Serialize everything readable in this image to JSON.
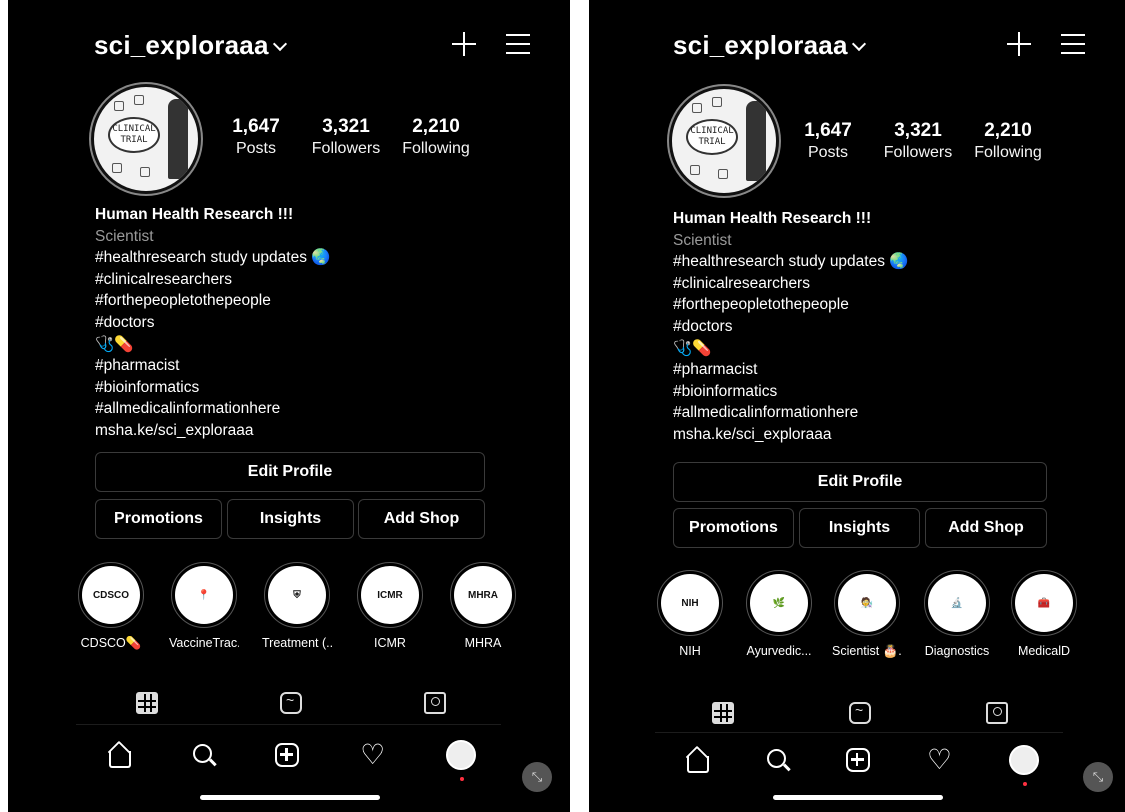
{
  "left": {
    "username": "sci_exploraaa",
    "avatar_text": "CLINICAL TRIAL",
    "stats": [
      {
        "num": "1,647",
        "label": "Posts"
      },
      {
        "num": "3,321",
        "label": "Followers"
      },
      {
        "num": "2,210",
        "label": "Following"
      }
    ],
    "bio": {
      "name": "Human Health Research !!!",
      "category": "Scientist",
      "lines": [
        "#healthresearch study updates 🌏",
        "#clinicalresearchers",
        "#forthepeopletothepeople",
        "#doctors",
        "🩺💊",
        "#pharmacist",
        "#bioinformatics",
        "#allmedicalinformationhere",
        "msha.ke/sci_exploraaa"
      ]
    },
    "buttons": {
      "edit": "Edit Profile",
      "promotions": "Promotions",
      "insights": "Insights",
      "add_shop": "Add Shop"
    },
    "highlights": [
      {
        "label": "CDSCO💊",
        "inner": "CDSCO"
      },
      {
        "label": "VaccineTrac...",
        "inner": "📍"
      },
      {
        "label": "Treatment (...",
        "inner": "⛨"
      },
      {
        "label": "ICMR",
        "inner": "ICMR"
      },
      {
        "label": "MHRA",
        "inner": "MHRA"
      }
    ]
  },
  "right": {
    "username": "sci_exploraaa",
    "avatar_text": "CLINICAL TRIAL",
    "stats": [
      {
        "num": "1,647",
        "label": "Posts"
      },
      {
        "num": "3,321",
        "label": "Followers"
      },
      {
        "num": "2,210",
        "label": "Following"
      }
    ],
    "bio": {
      "name": "Human Health Research !!!",
      "category": "Scientist",
      "lines": [
        "#healthresearch study updates 🌏",
        "#clinicalresearchers",
        "#forthepeopletothepeople",
        "#doctors",
        "🩺💊",
        "#pharmacist",
        "#bioinformatics",
        "#allmedicalinformationhere",
        "msha.ke/sci_exploraaa"
      ]
    },
    "buttons": {
      "edit": "Edit Profile",
      "promotions": "Promotions",
      "insights": "Insights",
      "add_shop": "Add Shop"
    },
    "highlights": [
      {
        "label": "NIH",
        "inner": "NIH"
      },
      {
        "label": "Ayurvedic...",
        "inner": "🌿"
      },
      {
        "label": "Scientist 🎂...",
        "inner": "🧑‍🔬"
      },
      {
        "label": "Diagnostics",
        "inner": "🔬"
      },
      {
        "label": "MedicalD",
        "inner": "🧰"
      }
    ]
  },
  "colors": {
    "background": "#000000",
    "text": "#ffffff",
    "secondary": "#9a9a9a",
    "border": "#3a3a3a",
    "notification_dot": "#ff3040"
  }
}
